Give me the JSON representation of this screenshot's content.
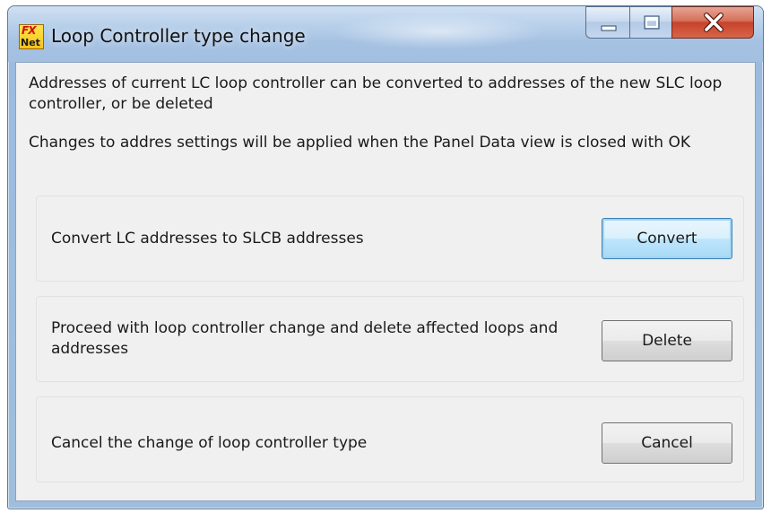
{
  "window": {
    "title": "Loop Controller type change",
    "icon_top": "FX",
    "icon_bottom": "Net"
  },
  "controls": {
    "minimize_icon": "minimize-icon",
    "maximize_icon": "maximize-icon",
    "close_icon": "close-icon"
  },
  "intro": {
    "line1": "Addresses of current LC loop controller can be converted to addresses of the new SLC loop controller, or be deleted",
    "line2": "Changes to addres settings will be applied when the Panel Data view is closed with OK"
  },
  "options": [
    {
      "label": "Convert LC addresses to SLCB addresses",
      "button": "Convert"
    },
    {
      "label": "Proceed with loop controller change and delete affected loops and addresses",
      "button": "Delete"
    },
    {
      "label": "Cancel the change of loop controller type",
      "button": "Cancel"
    }
  ],
  "colors": {
    "close_button": "#c7422a",
    "default_button_border": "#3c7fb1",
    "client_background": "#f0f0f0"
  }
}
